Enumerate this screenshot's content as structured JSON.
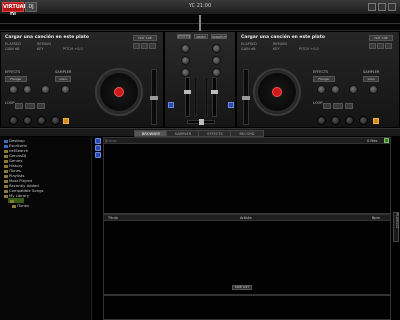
{
  "topbar": {
    "logo": "VIRTUAL DJ",
    "logo2": "DJ",
    "clock": "YC 21:00"
  },
  "deck_left": {
    "title": "Cargar una canción en este plato",
    "elapsed": "ELAPSED",
    "gain": "GAIN dB",
    "remain": "REMAIN",
    "key": "KEY",
    "pitch": "PITCH +0.0",
    "fx_label": "EFFECTS",
    "fx_value": "Flanger",
    "sampler_label": "SAMPLER",
    "sampler_value": "siren",
    "loop_label": "LOOP",
    "cue": "CUE",
    "keylock": "KEYLOCK",
    "hotcue": "HOT CUE"
  },
  "deck_right": {
    "title": "Cargar una canción en este plato",
    "elapsed": "ELAPSED",
    "gain": "GAIN dB",
    "remain": "REMAIN",
    "key": "KEY",
    "pitch": "PITCH +0.0",
    "fx_label": "EFFECTS",
    "fx_value": "Flanger",
    "sampler_label": "SAMPLER",
    "sampler_value": "siren",
    "loop_label": "LOOP",
    "cue": "CUE",
    "keylock": "KEYLOCK",
    "hotcue": "HOT CUE"
  },
  "mixer": {
    "tabs": [
      "MIXER",
      "VIDEO",
      "SCRATCH"
    ]
  },
  "tabs": [
    {
      "label": "BROWSER",
      "active": true
    },
    {
      "label": "SAMPLER",
      "active": false
    },
    {
      "label": "EFFECTS",
      "active": false
    },
    {
      "label": "RECORD",
      "active": false
    }
  ],
  "tree": [
    {
      "label": "Desktop",
      "icon": "folder-icon"
    },
    {
      "label": "Escritorio",
      "icon": "folder-icon"
    },
    {
      "label": "netSearch",
      "icon": "folder-icon"
    },
    {
      "label": "GeniusDJ",
      "icon": "folder-icon"
    },
    {
      "label": "Genres",
      "icon": "folder-icon"
    },
    {
      "label": "History",
      "icon": "folder-icon"
    },
    {
      "label": "iTunes",
      "icon": "folder-icon"
    },
    {
      "label": "Playlists",
      "icon": "folder-icon"
    },
    {
      "label": "Most Played",
      "icon": "folder-icon"
    },
    {
      "label": "Recently Added",
      "icon": "folder-icon"
    },
    {
      "label": "Compatible Songs",
      "icon": "folder-icon"
    },
    {
      "label": "My Library",
      "icon": "folder-icon"
    },
    {
      "label": "",
      "icon": "folder-icon",
      "selected": true
    },
    {
      "label": "iTunes",
      "icon": "folder-icon"
    }
  ],
  "search": {
    "label": "Buscar",
    "files_count": "0 files"
  },
  "columns": {
    "title": "Título",
    "artist": "Artista",
    "bpm": "Bpm"
  },
  "sidelist_button": "SIDE LIST",
  "side_tab": "PLAYLIST"
}
